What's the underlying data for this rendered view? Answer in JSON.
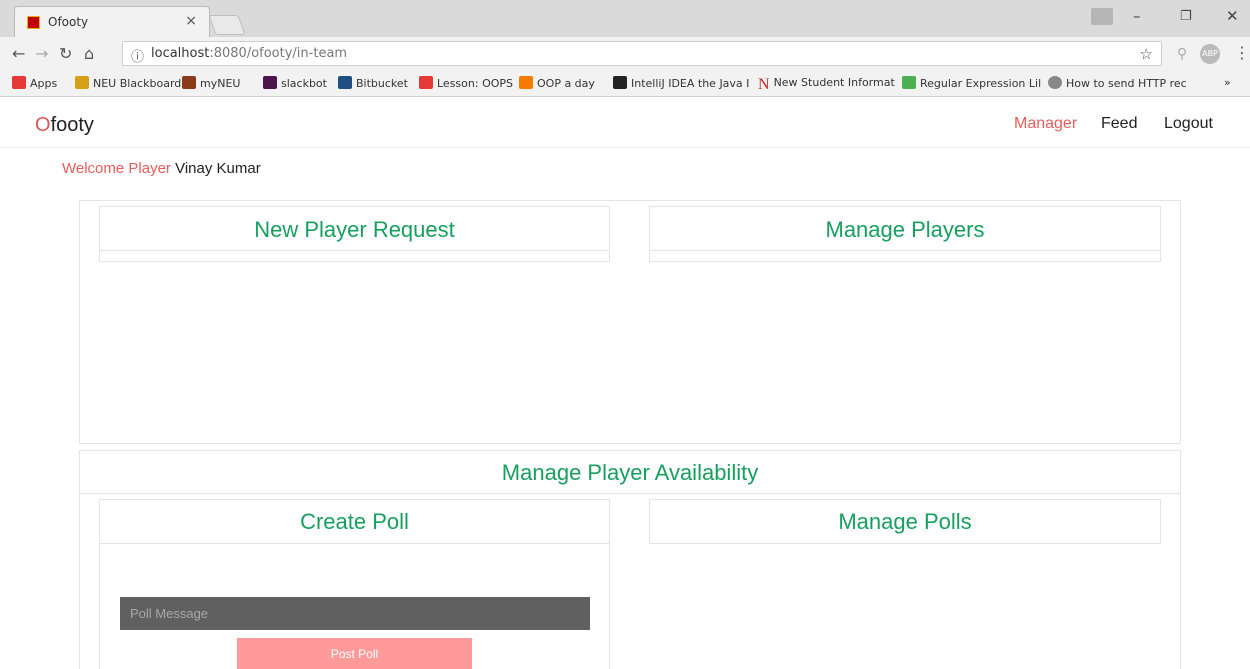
{
  "browser": {
    "tab_title": "Ofooty",
    "tab_close": "×",
    "url_host": "localhost",
    "url_rest": ":8080/ofooty/in-team",
    "bookmarks": [
      {
        "label": "Apps",
        "color": "#e53935"
      },
      {
        "label": "NEU Blackboard",
        "color": "#d4a017"
      },
      {
        "label": "myNEU",
        "color": "#8b3a1a"
      },
      {
        "label": "slackbot",
        "color": "#4a154b"
      },
      {
        "label": "Bitbucket",
        "color": "#205081"
      },
      {
        "label": "Lesson: OOPS",
        "color": "#e53935"
      },
      {
        "label": "OOP a day",
        "color": "#f57c00"
      },
      {
        "label": "IntelliJ IDEA the Java I",
        "color": "#222222"
      },
      {
        "label": "New Student Informat",
        "color": "#c62828"
      },
      {
        "label": "Regular Expression Lil",
        "color": "#4caf50"
      },
      {
        "label": "How to send HTTP rec",
        "color": "#888888"
      }
    ],
    "bookmarks_more": "»"
  },
  "app": {
    "logo_first": "O",
    "logo_rest": "footy",
    "nav": {
      "manager": "Manager",
      "feed": "Feed",
      "logout": "Logout"
    },
    "welcome_label": "Welcome Player",
    "welcome_name": "Vinay Kumar",
    "cards": {
      "new_player_request": "New Player Request",
      "manage_players": "Manage Players",
      "manage_player_availability": "Manage Player Availability",
      "create_poll": "Create Poll",
      "manage_polls": "Manage Polls"
    },
    "poll_placeholder": "Poll Message",
    "post_poll": "Post Poll",
    "colors": {
      "accent": "#e85b5b",
      "heading_green": "#17a05d",
      "button": "#ff9a9a",
      "input_bg": "#606060"
    }
  }
}
